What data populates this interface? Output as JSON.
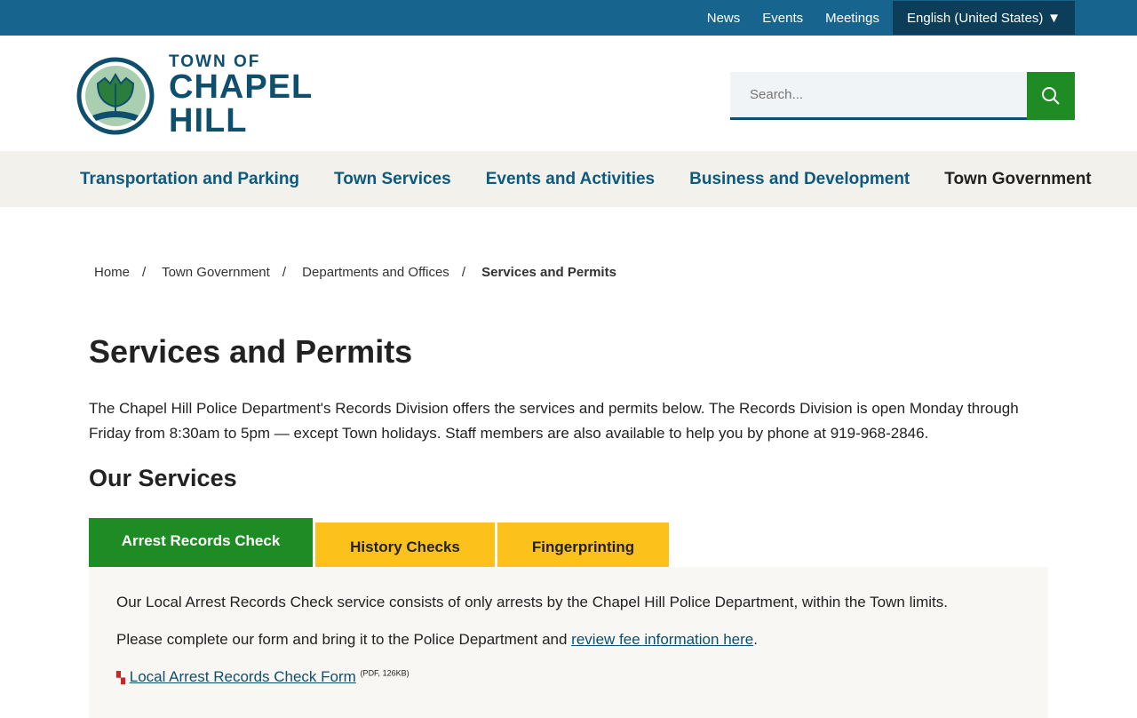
{
  "utility": {
    "links": [
      "News",
      "Events",
      "Meetings"
    ],
    "language": "English (United States)"
  },
  "logo": {
    "small": "TOWN OF",
    "line1": "CHAPEL",
    "line2": "HILL"
  },
  "search": {
    "placeholder": "Search..."
  },
  "nav": [
    "Transportation and Parking",
    "Town Services",
    "Events and Activities",
    "Business and Development",
    "Town Government"
  ],
  "breadcrumb": [
    "Home",
    "Town Government",
    "Departments and Offices",
    "Services and Permits"
  ],
  "title": "Services and Permits",
  "intro": "The Chapel Hill Police Department's Records Division offers the services and permits below. The Records Division is open Monday through Friday from 8:30am to 5pm — except Town holidays. Staff members are also available to help you by phone at 919-968-2846.",
  "services_heading": "Our Services",
  "tabs": [
    "Arrest Records Check",
    "History Checks",
    "Fingerprinting"
  ],
  "panel": {
    "p1": "Our Local Arrest Records Check service consists of only arrests by the Chapel Hill Police Department, within the Town limits.",
    "p2_pre": "Please complete our form and bring it to the Police Department and ",
    "p2_link": "review fee information here",
    "p2_post": ".",
    "file_link": "Local Arrest Records Check Form",
    "file_meta": "(PDF, 126KB)"
  }
}
